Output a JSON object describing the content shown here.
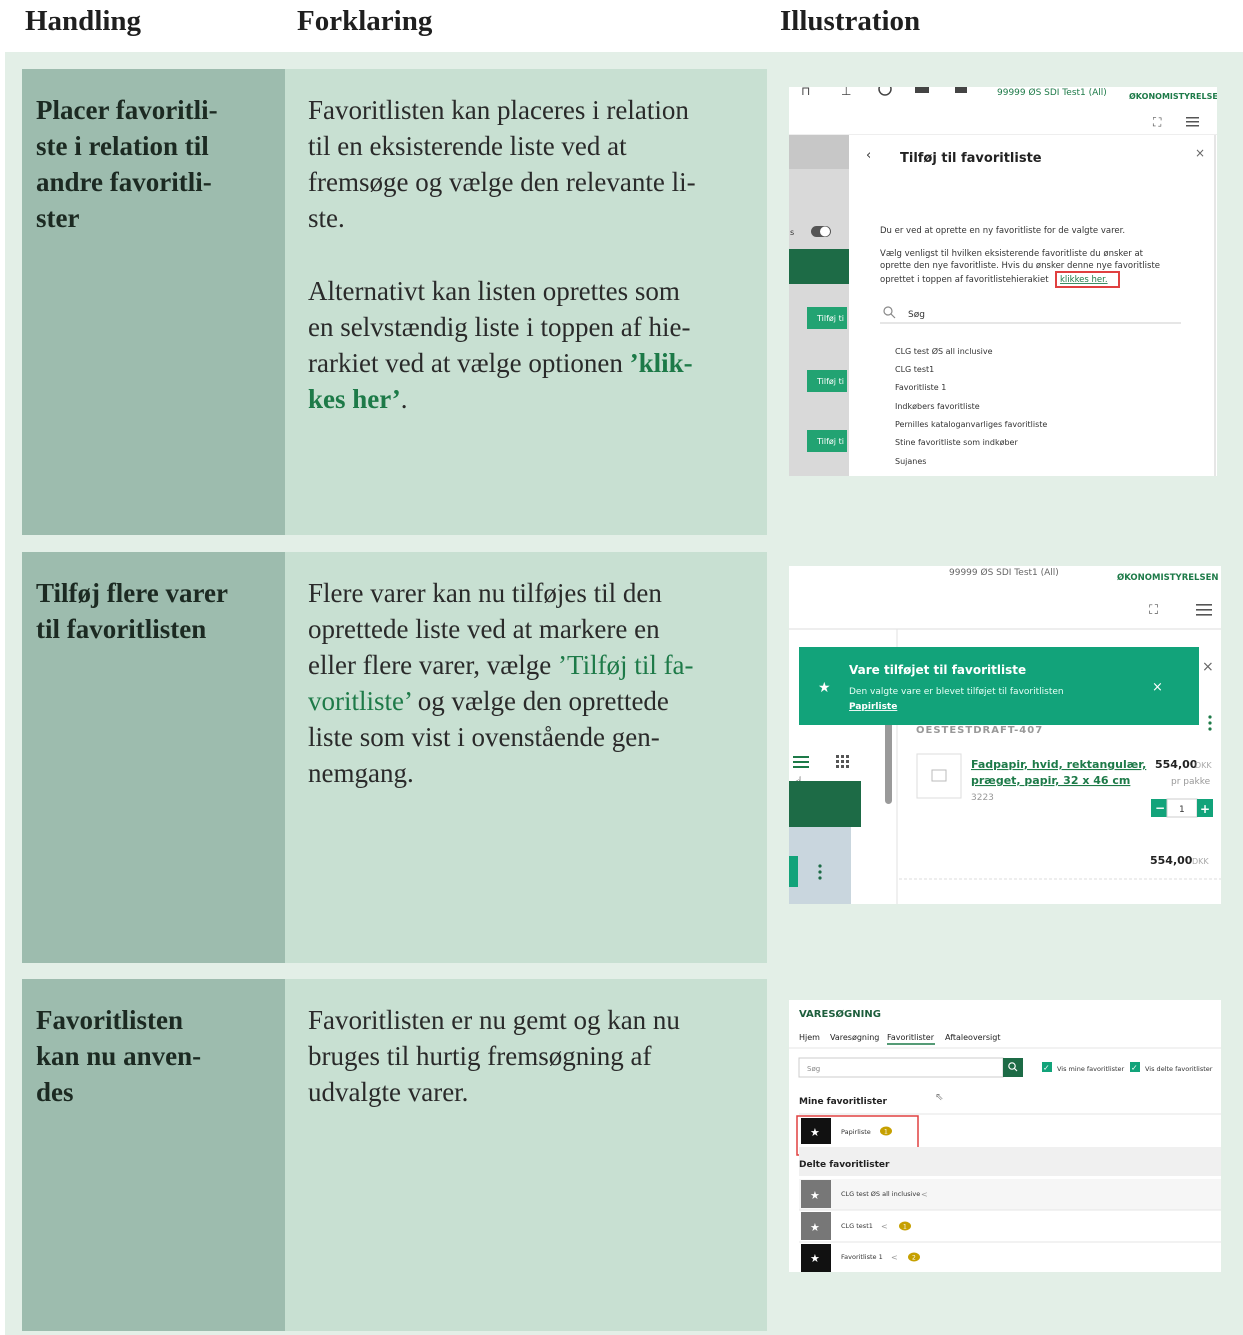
{
  "columns": {
    "handling": "Handling",
    "forklaring": "Forklaring",
    "illustration": "Illustration"
  },
  "rows": [
    {
      "handling_lines": [
        "Placer favoritli-",
        "ste i relation til",
        "andre favoritli-",
        "ster"
      ],
      "forklaring_p1": [
        "Favoritlisten kan placeres i relation",
        "til en eksisterende liste ved at",
        "fremsøge og vælge den relevante li-",
        "ste."
      ],
      "forklaring_p2": [
        "Alternativt kan listen oprettes som",
        "en selvstændig liste i toppen af hie-",
        "rarkiet ved at vælge optionen "
      ],
      "forklaring_p2_highlight_a": "’klik-",
      "forklaring_p2_highlight_b": "kes her’",
      "forklaring_p2_end": "."
    },
    {
      "handling_lines": [
        "Tilføj flere varer",
        "til favoritlisten"
      ],
      "forklaring_lines": [
        "Flere varer kan nu tilføjes til den",
        "oprettede liste ved at markere en",
        "eller flere varer, vælge "
      ],
      "forklaring_quote_a": "’Tilføj til fa-",
      "forklaring_quote_b": "voritliste’",
      "forklaring_rest": [
        " og vælge den oprettede",
        "liste som vist i ovenstående gen-",
        "nemgang."
      ]
    },
    {
      "handling_lines": [
        "Favoritlisten",
        "kan nu anven-",
        "des"
      ],
      "forklaring_lines": [
        "Favoritlisten er nu gemt og kan nu",
        "bruges til hurtig fremsøgning af",
        "udvalgte varer."
      ]
    }
  ],
  "ill1": {
    "account": "99999 ØS SDI Test1 (All)",
    "brand": "ØKONOMISTYRELSEN",
    "dialog_title": "Tilføj til favoritliste",
    "intro": "Du er ved at oprette en ny favoritliste for de valgte varer.",
    "instr1": "Vælg venligst til hvilken eksisterende favoritliste du ønsker at",
    "instr2": "oprette den nye favoritliste. Hvis du ønsker denne nye favoritliste",
    "instr3": "oprettet i toppen af favoritlistehierakiet",
    "link": "klikkes her.",
    "search_placeholder": "Søg",
    "bg_button": "Tilføj ti",
    "lists": [
      "CLG test ØS all inclusive",
      "CLG test1",
      "Favoritliste 1",
      "Indkøbers favoritliste",
      "Pernilles kataloganvarliges favoritliste",
      "Stine favoritliste som indkøber",
      "Sujanes"
    ]
  },
  "ill2": {
    "account": "99999 ØS SDI Test1 (All)",
    "brand": "ØKONOMISTYRELSEN",
    "toast_title": "Vare tilføjet til favoritliste",
    "toast_msg": "Den valgte vare er blevet tilføjet til favoritlisten",
    "toast_link": "Papirliste",
    "draft": "OESTESTDRAFT-407",
    "product_l1": "Fadpapir, hvid, rektangulær,",
    "product_l2": "præget, papir, 32 x 46 cm",
    "sku": "3223",
    "price": "554,00",
    "currency": "DKK",
    "unit": "pr pakke",
    "qty": "1",
    "total": "554,00",
    "total_currency": "DKK"
  },
  "ill3": {
    "title": "VARESØGNING",
    "nav": [
      "Hjem",
      "Varesøgning",
      "Favoritlister",
      "Aftaleoversigt"
    ],
    "search_placeholder": "Søg",
    "chk_mine": "Vis mine favoritlister",
    "chk_delte": "Vis delte favoritlister",
    "mine_header": "Mine favoritlister",
    "mine_item": "Papirliste",
    "mine_badge": "1",
    "delte_header": "Delte favoritlister",
    "delte_items": [
      {
        "name": "CLG test ØS all inclusive",
        "badge": ""
      },
      {
        "name": "CLG test1",
        "badge": "1"
      },
      {
        "name": "Favoritliste 1",
        "badge": "2"
      }
    ]
  },
  "colors": {
    "accent": "#1d7a48",
    "handling_col": "#9dbcae",
    "forklaring_col": "#c8e0d2",
    "toast": "#12a37a",
    "highlight_box": "#e04040"
  }
}
